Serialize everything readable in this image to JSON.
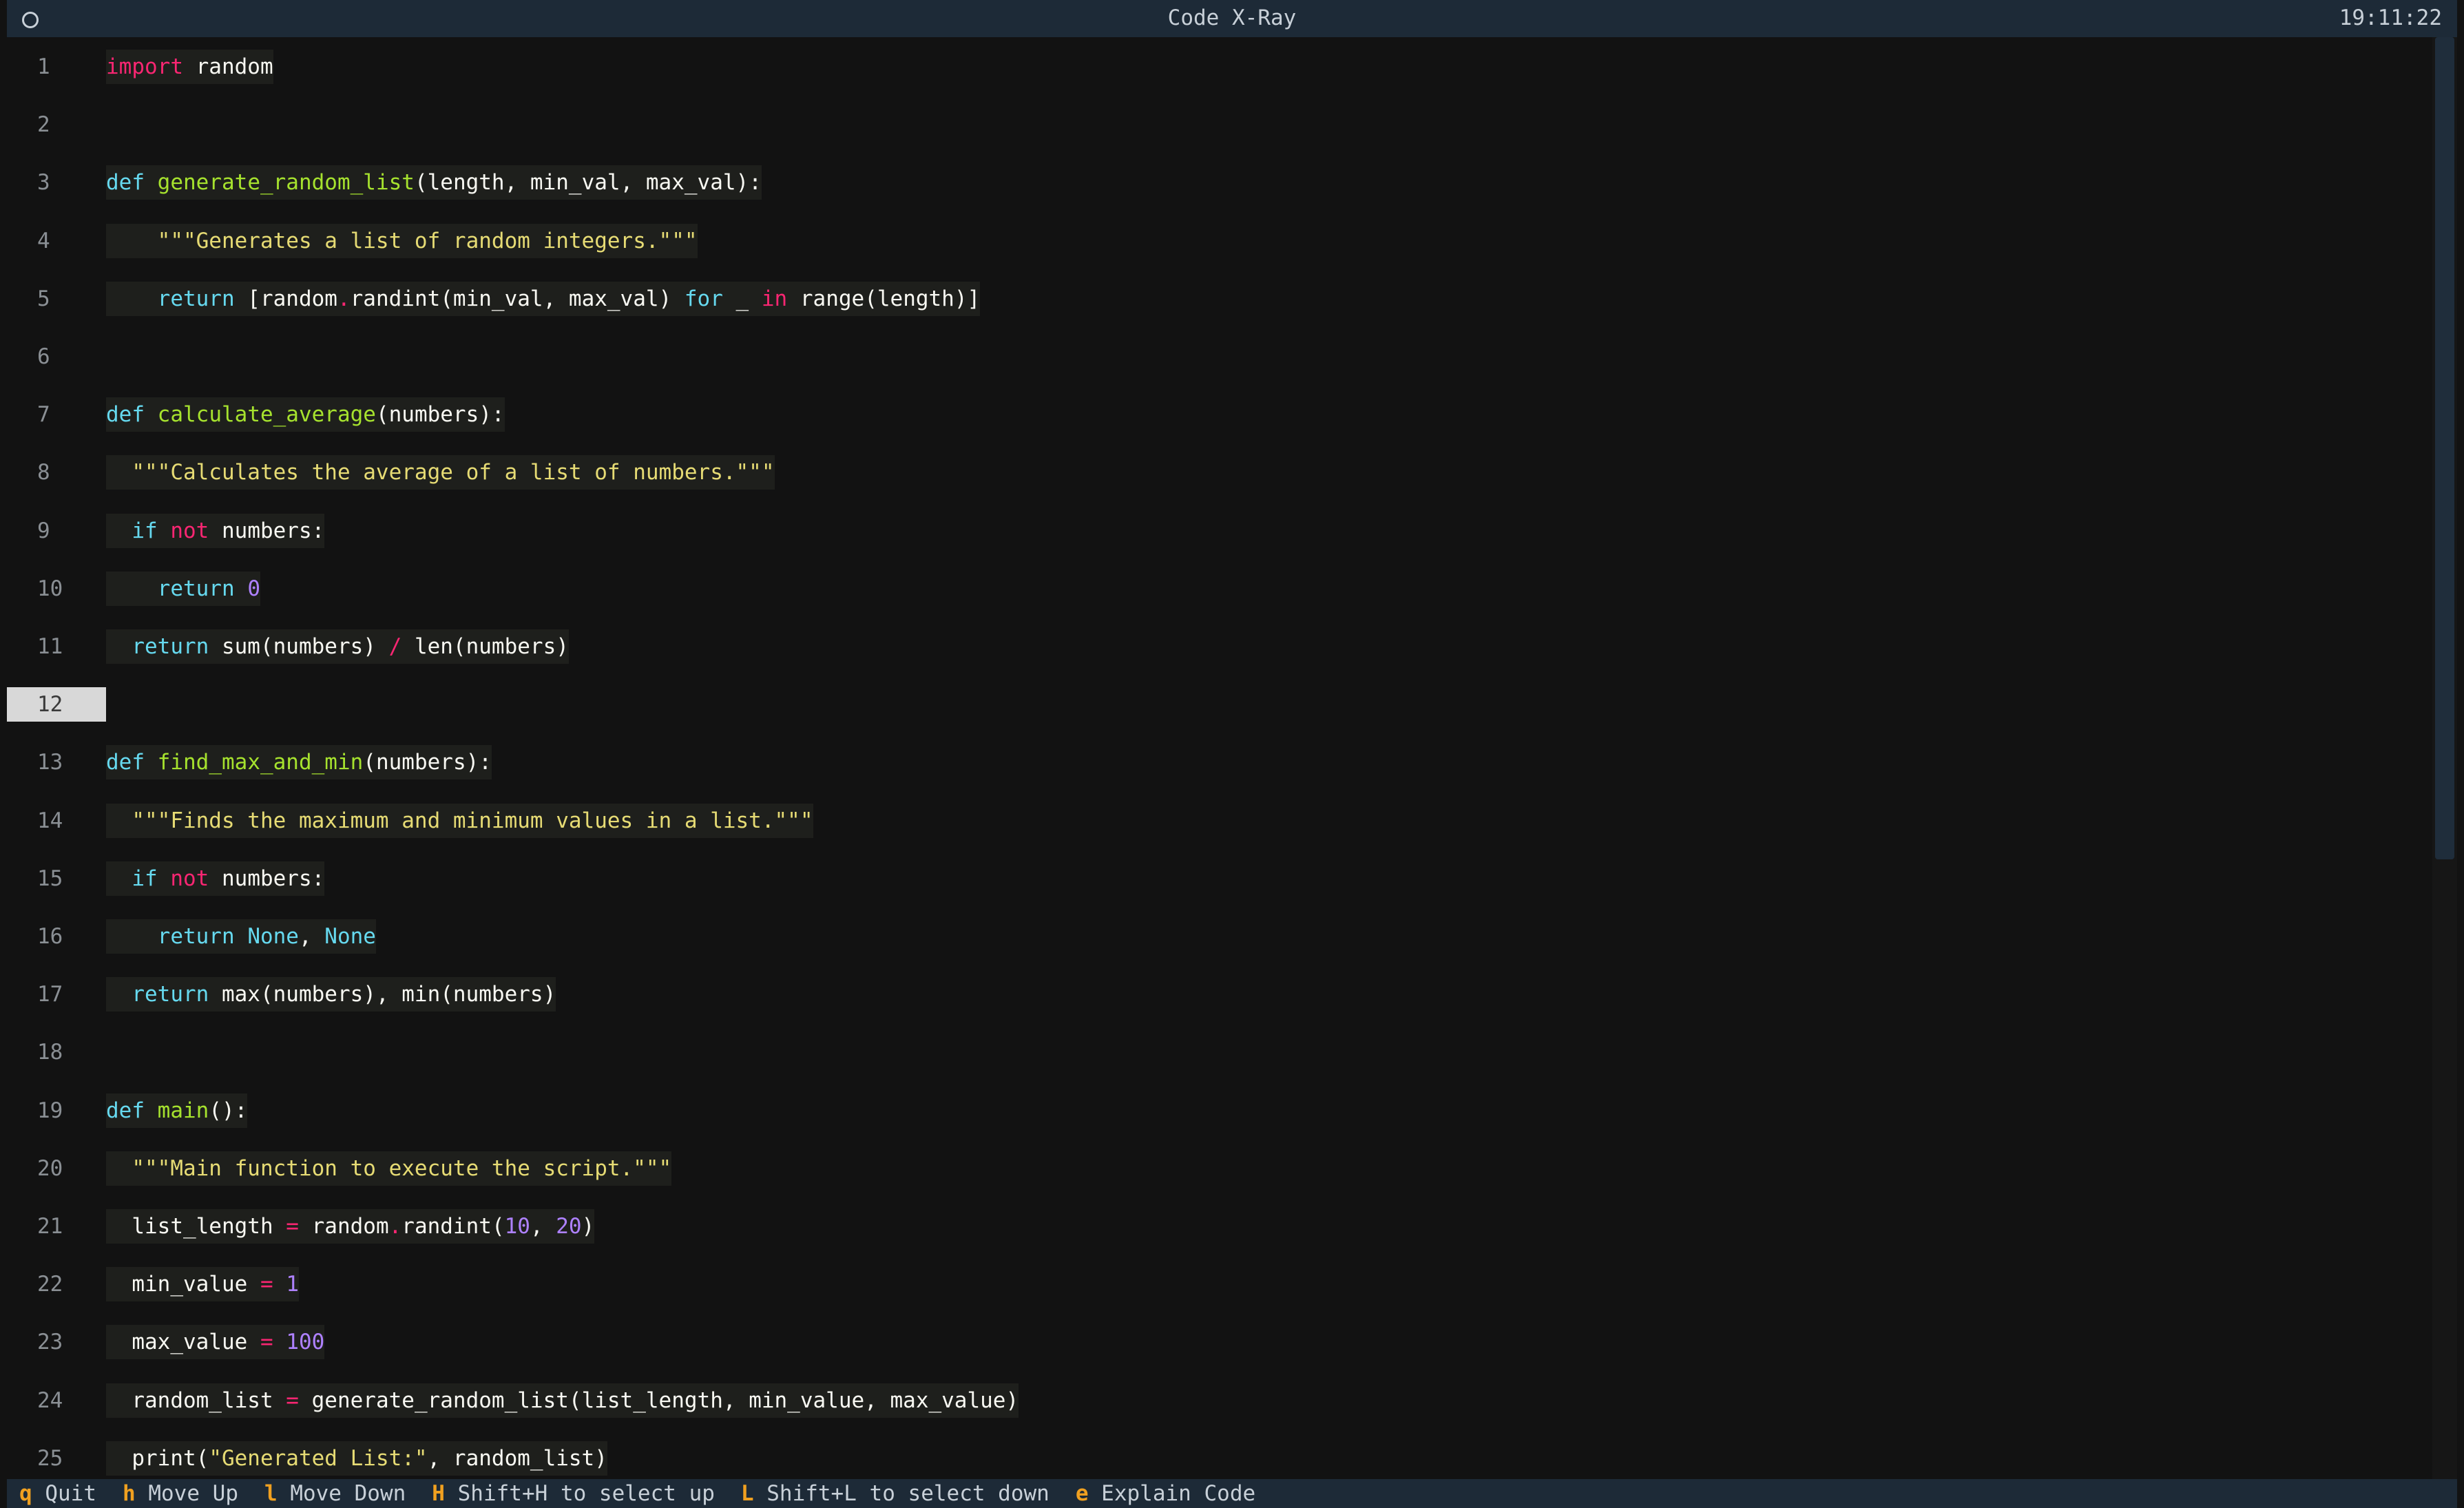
{
  "window": {
    "title": "Code X-Ray",
    "clock": "19:11:22"
  },
  "editor": {
    "current_line": 12,
    "lines": [
      {
        "n": "1",
        "html": "<span class=\"k-red\">import</span> random"
      },
      {
        "n": "2",
        "html": ""
      },
      {
        "n": "3",
        "html": "<span class=\"k-cyan\">def</span> <span class=\"k-green\">generate_random_list</span>(length, min_val, max_val):"
      },
      {
        "n": "4",
        "html": "    <span class=\"k-yellow\">\"\"\"Generates a list of random integers.\"\"\"</span>"
      },
      {
        "n": "5",
        "html": "    <span class=\"k-cyan\">return</span> [random<span class=\"k-red\">.</span>randint(min_val, max_val) <span class=\"k-cyan\">for</span> _ <span class=\"k-red\">in</span> range(length)]"
      },
      {
        "n": "6",
        "html": ""
      },
      {
        "n": "7",
        "html": "<span class=\"k-cyan\">def</span> <span class=\"k-green\">calculate_average</span>(numbers):"
      },
      {
        "n": "8",
        "html": "  <span class=\"k-yellow\">\"\"\"Calculates the average of a list of numbers.\"\"\"</span>"
      },
      {
        "n": "9",
        "html": "  <span class=\"k-cyan\">if</span> <span class=\"k-red\">not</span> numbers:"
      },
      {
        "n": "10",
        "html": "    <span class=\"k-cyan\">return</span> <span class=\"k-purple\">0</span>"
      },
      {
        "n": "11",
        "html": "  <span class=\"k-cyan\">return</span> sum(numbers) <span class=\"k-red\">/</span> len(numbers)"
      },
      {
        "n": "12",
        "html": ""
      },
      {
        "n": "13",
        "html": "<span class=\"k-cyan\">def</span> <span class=\"k-green\">find_max_and_min</span>(numbers):"
      },
      {
        "n": "14",
        "html": "  <span class=\"k-yellow\">\"\"\"Finds the maximum and minimum values in a list.\"\"\"</span>"
      },
      {
        "n": "15",
        "html": "  <span class=\"k-cyan\">if</span> <span class=\"k-red\">not</span> numbers:"
      },
      {
        "n": "16",
        "html": "    <span class=\"k-cyan\">return</span> <span class=\"k-cyan\">None</span>, <span class=\"k-cyan\">None</span>"
      },
      {
        "n": "17",
        "html": "  <span class=\"k-cyan\">return</span> max(numbers), min(numbers)"
      },
      {
        "n": "18",
        "html": ""
      },
      {
        "n": "19",
        "html": "<span class=\"k-cyan\">def</span> <span class=\"k-green\">main</span>():"
      },
      {
        "n": "20",
        "html": "  <span class=\"k-yellow\">\"\"\"Main function to execute the script.\"\"\"</span>"
      },
      {
        "n": "21",
        "html": "  list_length <span class=\"k-red\">=</span> random<span class=\"k-red\">.</span>randint(<span class=\"k-purple\">10</span>, <span class=\"k-purple\">20</span>)"
      },
      {
        "n": "22",
        "html": "  min_value <span class=\"k-red\">=</span> <span class=\"k-purple\">1</span>"
      },
      {
        "n": "23",
        "html": "  max_value <span class=\"k-red\">=</span> <span class=\"k-purple\">100</span>"
      },
      {
        "n": "24",
        "html": "  random_list <span class=\"k-red\">=</span> generate_random_list(list_length, min_value, max_value)"
      },
      {
        "n": "25",
        "html": "  print(<span class=\"k-yellow\">\"Generated List:\"</span>, random_list)"
      }
    ]
  },
  "footer": {
    "items": [
      {
        "key": "q",
        "label": "Quit"
      },
      {
        "key": "h",
        "label": "Move Up"
      },
      {
        "key": "l",
        "label": "Move Down"
      },
      {
        "key": "H",
        "label": "Shift+H to select up"
      },
      {
        "key": "L",
        "label": "Shift+L to select down"
      },
      {
        "key": "e",
        "label": "Explain Code"
      }
    ]
  },
  "colors": {
    "keyword_red": "#f92672",
    "keyword_cyan": "#66d9ef",
    "function_green": "#a6e22e",
    "string_yellow": "#e6db74",
    "number_purple": "#ae81ff",
    "footer_key": "#f0a020",
    "chrome_bg": "#1d2a37"
  }
}
